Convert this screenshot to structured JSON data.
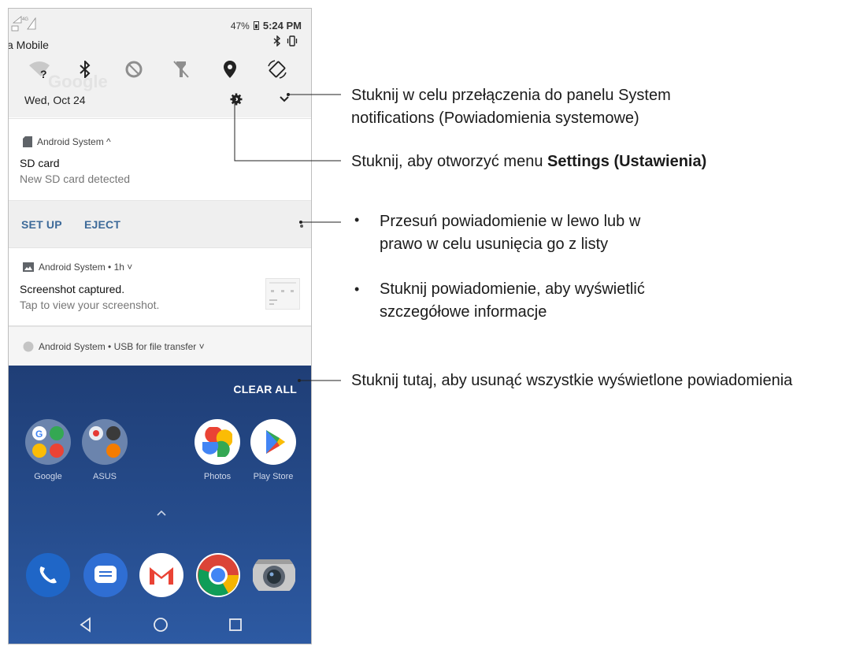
{
  "status_bar": {
    "carrier": "a Mobile",
    "battery_percent": "47%",
    "time": "5:24 PM"
  },
  "quick_settings": {
    "date": "Wed, Oct 24",
    "icons": [
      "wifi-unknown-icon",
      "bluetooth-icon",
      "data-saver-icon",
      "flashlight-off-icon",
      "location-icon",
      "auto-rotate-icon"
    ],
    "ghost_search_label": "Google"
  },
  "notifications": [
    {
      "app_header": "Android System ^",
      "title": "SD card",
      "body": "New SD card detected",
      "actions": [
        "SET UP",
        "EJECT"
      ]
    },
    {
      "app_header": "Android System • 1h ˅",
      "title": "Screenshot captured.",
      "body": "Tap to view your screenshot."
    },
    {
      "app_header": "Android System • USB for file transfer ˅"
    }
  ],
  "home": {
    "clear_all_label": "CLEAR ALL",
    "apps": [
      "Google",
      "ASUS",
      "Photos",
      "Play Store"
    ],
    "dock": [
      "phone-icon",
      "messages-icon",
      "gmail-icon",
      "chrome-icon",
      "camera-icon"
    ],
    "nav": [
      "back-button",
      "home-button",
      "recents-button"
    ]
  },
  "callouts": {
    "panel_line1": "Stuknij w celu przełączenia do panelu System",
    "panel_line2": "notifications (Powiadomienia systemowe)",
    "settings_prefix": "Stuknij, aby otworzyć menu ",
    "settings_bold": "Settings (Ustawienia)",
    "swipe_line1": "Przesuń powiadomienie w lewo lub w",
    "swipe_line2": "prawo w celu usunięcia go z listy",
    "tap_line1": "Stuknij powiadomienie, aby wyświetlić",
    "tap_line2": "szczegółowe informacje",
    "clear_all": "Stuknij tutaj, aby usunąć wszystkie wyświetlone powiadomienia",
    "bullet_symbol": "•"
  },
  "colors": {
    "action_blue": "#3d6a99",
    "home_bg": "#264c8c",
    "leader_line": "#222222"
  }
}
